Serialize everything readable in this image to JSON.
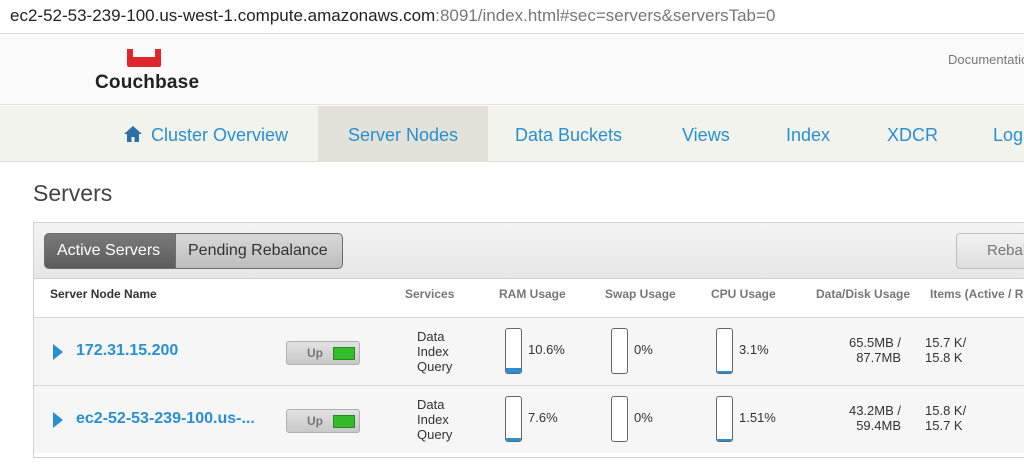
{
  "browser": {
    "url_main": "ec2-52-53-239-100.us-west-1.compute.amazonaws.com",
    "url_rest": ":8091/index.html#sec=servers&serversTab=0"
  },
  "header": {
    "brand": "Couchbase",
    "documentation_link": "Documentation"
  },
  "nav": {
    "items": [
      {
        "label": "Cluster Overview"
      },
      {
        "label": "Server Nodes"
      },
      {
        "label": "Data Buckets"
      },
      {
        "label": "Views"
      },
      {
        "label": "Index"
      },
      {
        "label": "XDCR"
      },
      {
        "label": "Log"
      }
    ],
    "active": "Server Nodes"
  },
  "page": {
    "title": "Servers"
  },
  "tabs": {
    "active_servers": "Active Servers",
    "pending_rebalance": "Pending Rebalance",
    "rebalance_button": "Rebalance"
  },
  "columns": {
    "name": "Server Node Name",
    "services": "Services",
    "ram": "RAM Usage",
    "swap": "Swap Usage",
    "cpu": "CPU Usage",
    "disk": "Data/Disk Usage",
    "items": "Items (Active / Replica)"
  },
  "servers": [
    {
      "name": "172.31.15.200",
      "status": "Up",
      "services": [
        "Data",
        "Index",
        "Query"
      ],
      "ram_pct": 10.6,
      "ram_label": "10.6%",
      "swap_pct": 0,
      "swap_label": "0%",
      "cpu_pct": 3.1,
      "cpu_label": "3.1%",
      "data_usage": "65.5MB /",
      "disk_usage": "87.7MB",
      "items_active": "15.7 K/",
      "items_replica": "15.8 K"
    },
    {
      "name": "ec2-52-53-239-100.us-...",
      "status": "Up",
      "services": [
        "Data",
        "Index",
        "Query"
      ],
      "ram_pct": 7.6,
      "ram_label": "7.6%",
      "swap_pct": 0,
      "swap_label": "0%",
      "cpu_pct": 1.51,
      "cpu_label": "1.51%",
      "data_usage": "43.2MB /",
      "disk_usage": "59.4MB",
      "items_active": "15.8 K/",
      "items_replica": "15.7 K"
    }
  ],
  "colors": {
    "accent": "#2a8fd0",
    "status_up": "#33bb2a",
    "logo_red": "#e0262d"
  },
  "icons": {
    "home": "home-icon",
    "expand": "expand-arrow-icon",
    "logo": "couchbase-logo-icon"
  }
}
